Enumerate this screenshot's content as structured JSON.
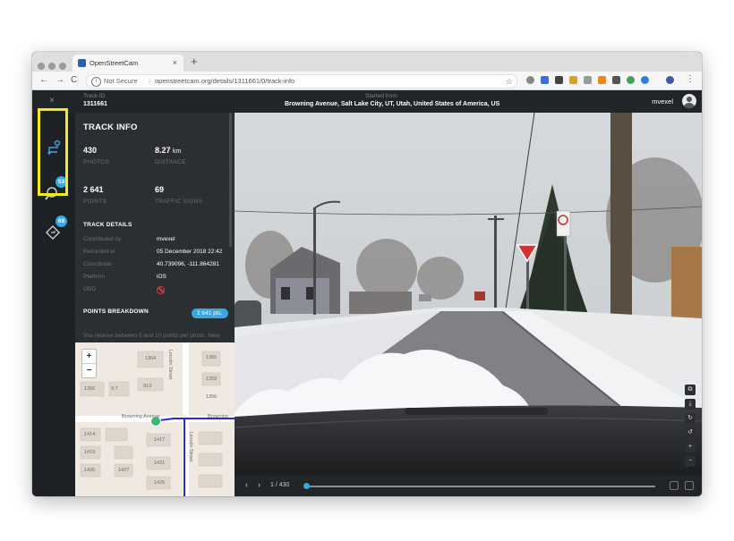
{
  "browser": {
    "tab_title": "OpenStreetCam",
    "tab_close": "×",
    "new_tab": "+",
    "security_label": "Not Secure",
    "url": "openstreetcam.org/details/1311661/0/track-info",
    "back": "←",
    "forward": "→",
    "reload": "C",
    "bookmark_star": "☆",
    "menu": "⋮"
  },
  "header": {
    "close": "×",
    "track_id_label": "Track ID",
    "track_id": "1311661",
    "started_from_label": "Started from",
    "started_from": "Browning Avenue, Salt Lake City, UT, Utah, United States of America, US",
    "username": "mvexel"
  },
  "rail": {
    "badges": [
      "53",
      "69"
    ]
  },
  "track_info": {
    "title": "TRACK INFO",
    "photos_value": "430",
    "photos_label": "PHOTOS",
    "distance_value": "8.27",
    "distance_unit": "km",
    "distance_label": "DISTANCE",
    "points_value": "2 641",
    "points_label": "POINTS",
    "signs_value": "69",
    "signs_label": "TRAFFIC SIGNS",
    "details_title": "TRACK DETAILS",
    "details": [
      {
        "key": "Contributed by",
        "value": "mvexel"
      },
      {
        "key": "Recorded at",
        "value": "05 December 2018 22:42"
      },
      {
        "key": "Coordinate",
        "value": "40.739096, -111.864281"
      },
      {
        "key": "Platform",
        "value": "iOS"
      },
      {
        "key": "OBD",
        "value": ""
      }
    ],
    "breakdown_title": "POINTS BREAKDOWN",
    "breakdown_badge": "2 641 pts.",
    "breakdown_text": "You receive between 0 and 10 points per photo. New"
  },
  "map": {
    "zoom_in": "+",
    "zoom_out": "−",
    "labels": {
      "street_browning": "Browning Avenue",
      "street_browning_right": "Browning",
      "street_lincoln": "Lincoln Street",
      "street_lincoln_lower": "Lincoln Street",
      "numbers": [
        "1364",
        "1365",
        "1359",
        "1356",
        "1356",
        "9.7",
        "913",
        "1414",
        "1419",
        "1417",
        "1426",
        "1421",
        "1427",
        "1425"
      ]
    }
  },
  "viewer": {
    "counter": "1 / 430",
    "progress": 0.0,
    "prev": "‹",
    "next": "›",
    "tools": [
      "⧉",
      "⤓",
      "↻",
      "↺",
      "+",
      "−"
    ]
  },
  "colors": {
    "accent": "#39a8e0",
    "highlight": "#f2ea1d",
    "route": "#2c2ad6",
    "panel": "#2b2e33"
  }
}
